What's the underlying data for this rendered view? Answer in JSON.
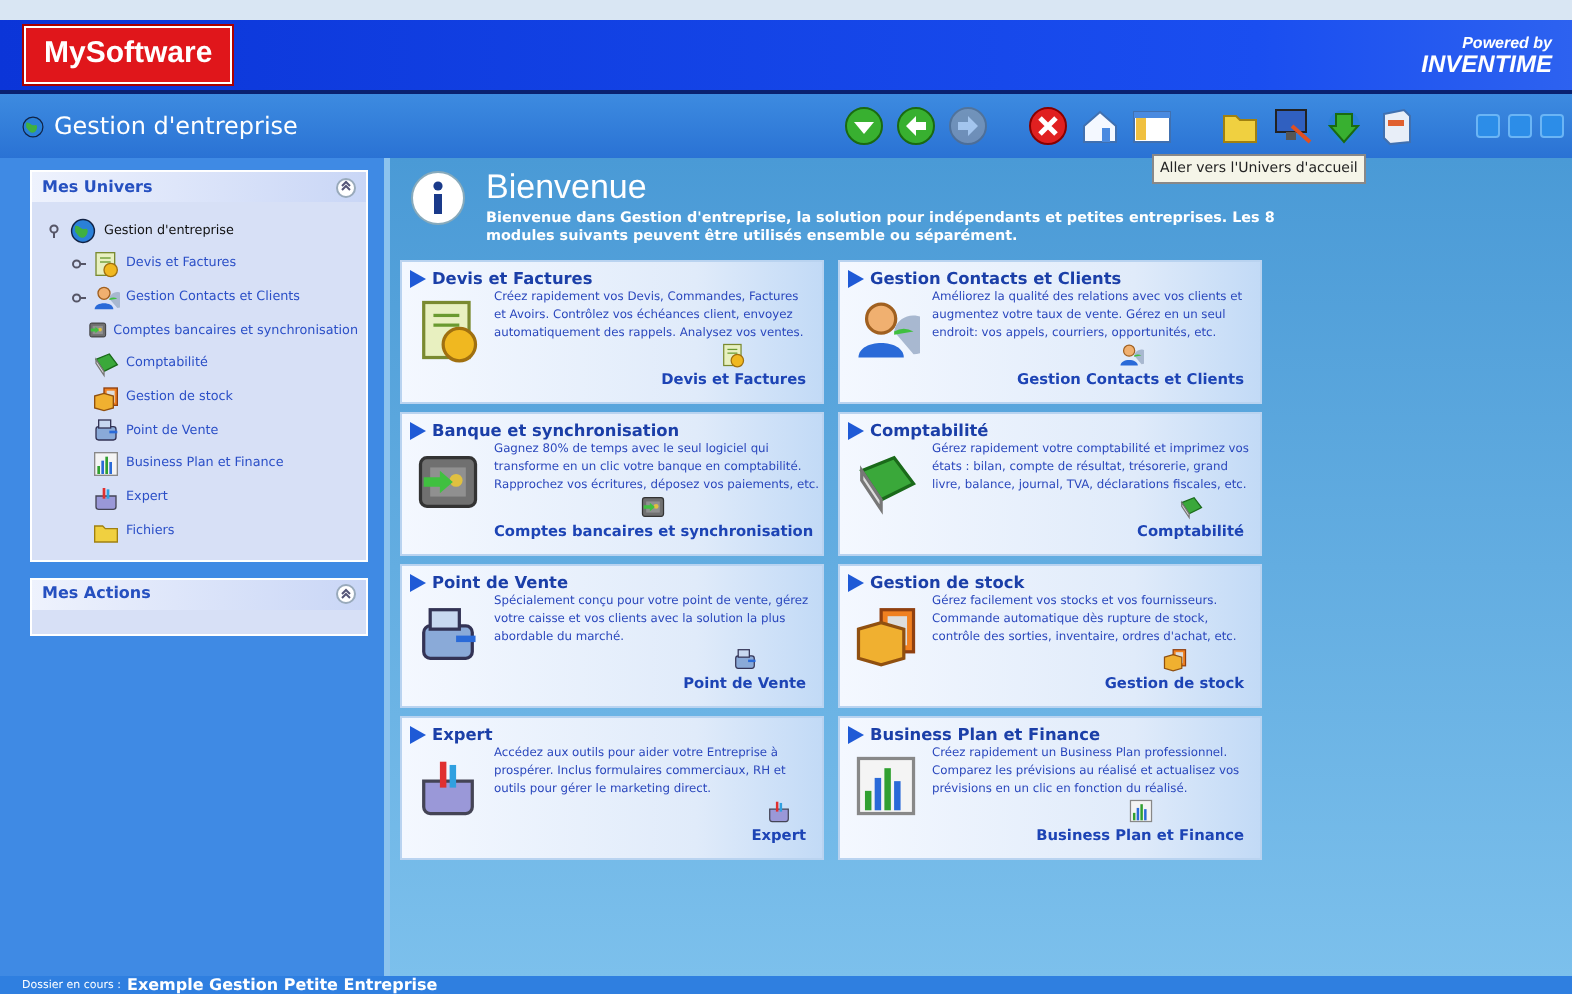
{
  "header": {
    "logo": "MySoftware",
    "powered_by": "Powered by",
    "brand": "INVENTIME"
  },
  "titlebar": {
    "title": "Gestion d'entreprise",
    "toolbar": [
      {
        "kind": "down",
        "disabled": false
      },
      {
        "kind": "back",
        "disabled": false
      },
      {
        "kind": "forward",
        "disabled": true
      },
      {
        "kind": "close",
        "disabled": false
      },
      {
        "kind": "home",
        "disabled": false
      },
      {
        "kind": "window",
        "disabled": false
      },
      {
        "kind": "folder",
        "disabled": false
      },
      {
        "kind": "monitor",
        "disabled": false
      },
      {
        "kind": "download",
        "disabled": false
      },
      {
        "kind": "box",
        "disabled": false
      }
    ],
    "tooltip": "Aller vers l'Univers d'accueil"
  },
  "sidebar": {
    "panels": [
      {
        "title": "Mes Univers",
        "tree": [
          {
            "label": "Gestion d'entreprise",
            "kind": "globe",
            "expanded": true,
            "children": [
              {
                "label": "Devis et Factures",
                "kind": "invoice",
                "expanded": false
              },
              {
                "label": "Gestion Contacts et Clients",
                "kind": "contacts",
                "expanded": false
              },
              {
                "label": "Comptes bancaires et synchronisation",
                "kind": "bank"
              },
              {
                "label": "Comptabilité",
                "kind": "accounting"
              },
              {
                "label": "Gestion de stock",
                "kind": "stock"
              },
              {
                "label": "Point de Vente",
                "kind": "pos"
              },
              {
                "label": "Business Plan et Finance",
                "kind": "finance"
              },
              {
                "label": "Expert",
                "kind": "expert"
              },
              {
                "label": "Fichiers",
                "kind": "folder"
              }
            ]
          }
        ]
      },
      {
        "title": "Mes Actions"
      }
    ]
  },
  "welcome": {
    "title": "Bienvenue",
    "intro": "Bienvenue dans Gestion d'entreprise, la solution pour indépendants et petites entreprises. Les 8 modules suivants peuvent être utilisés ensemble ou séparément."
  },
  "modules": [
    {
      "kind": "invoice",
      "title": "Devis et Factures",
      "description": "Créez rapidement vos Devis, Commandes, Factures et Avoirs. Contrôlez vos échéances client, envoyez automatiquement des rappels. Analysez vos ventes.",
      "link": "Devis et Factures"
    },
    {
      "kind": "contacts",
      "title": "Gestion Contacts et Clients",
      "description": "Améliorez la qualité des relations avec vos clients et augmentez votre taux de vente. Gérez en un seul endroit: vos appels, courriers, opportunités, etc.",
      "link": "Gestion Contacts et Clients"
    },
    {
      "kind": "bank",
      "title": "Banque et synchronisation",
      "description": "Gagnez 80% de temps avec le seul logiciel qui transforme en un clic votre banque en comptabilité. Rapprochez vos écritures, déposez vos paiements, etc.",
      "link": "Comptes bancaires et synchronisation"
    },
    {
      "kind": "accounting",
      "title": "Comptabilité",
      "description": "Gérez rapidement votre comptabilité et imprimez vos états : bilan, compte de résultat, trésorerie, grand livre, balance, journal, TVA, déclarations fiscales, etc.",
      "link": "Comptabilité"
    },
    {
      "kind": "pos",
      "title": "Point de Vente",
      "description": "Spécialement conçu pour votre point de vente, gérez votre caisse et vos clients avec la solution la plus abordable du marché.",
      "link": "Point de Vente"
    },
    {
      "kind": "stock",
      "title": "Gestion de stock",
      "description": "Gérez facilement vos stocks et vos fournisseurs. Commande automatique dès rupture de stock, contrôle des sorties, inventaire, ordres d'achat, etc.",
      "link": "Gestion de stock"
    },
    {
      "kind": "expert",
      "title": "Expert",
      "description": "Accédez aux outils pour aider votre Entreprise à prospérer. Inclus formulaires commerciaux, RH et outils pour gérer le marketing direct.",
      "link": "Expert"
    },
    {
      "kind": "finance",
      "title": "Business Plan et Finance",
      "description": "Créez rapidement un Business Plan professionnel. Comparez les prévisions au réalisé et actualisez vos prévisions en un clic en fonction du réalisé.",
      "link": "Business Plan et Finance"
    }
  ],
  "status_bar": {
    "label": "Dossier en cours :",
    "value": "Exemple  Gestion  Petite  Entreprise"
  }
}
